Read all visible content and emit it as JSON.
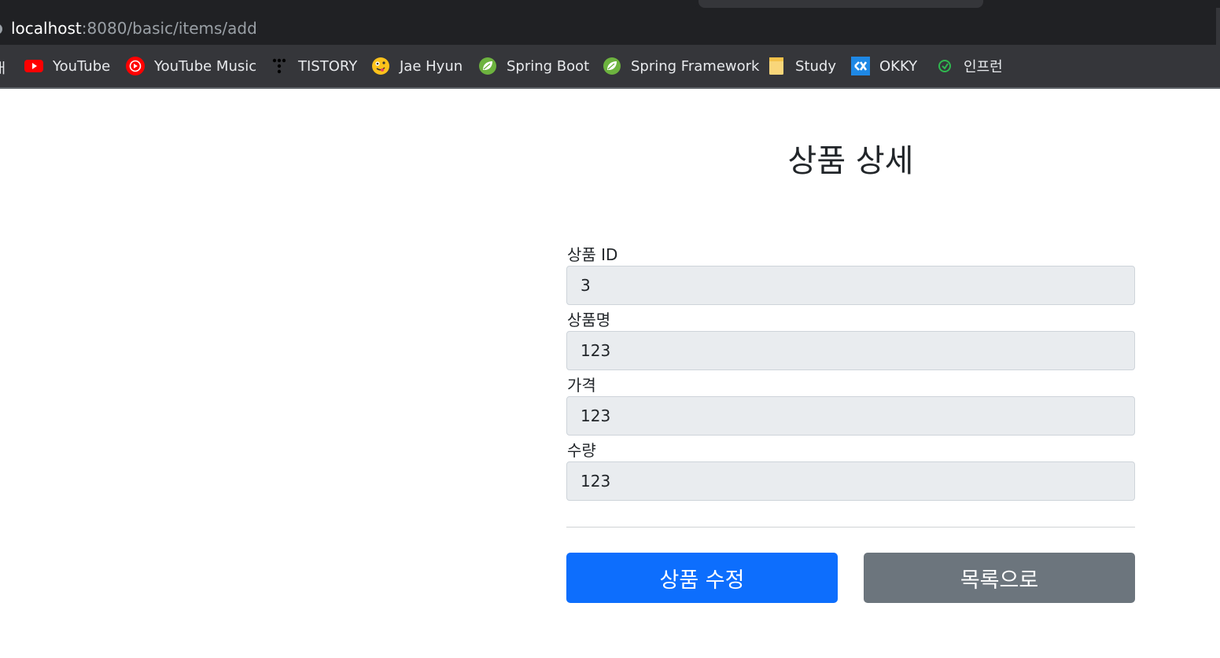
{
  "browser": {
    "url_host": "localhost",
    "url_path": ":8080/basic/items/add",
    "cut_bookmark": "ㅐ",
    "bookmarks": [
      {
        "label": "YouTube",
        "icon": "youtube-icon"
      },
      {
        "label": "YouTube Music",
        "icon": "youtube-music-icon"
      },
      {
        "label": "TISTORY",
        "icon": "tistory-icon"
      },
      {
        "label": "Jae Hyun",
        "icon": "emoji-face-icon"
      },
      {
        "label": "Spring Boot",
        "icon": "spring-leaf-icon"
      },
      {
        "label": "Spring Framework",
        "icon": "spring-leaf-icon"
      },
      {
        "label": "Study",
        "icon": "folder-note-icon"
      },
      {
        "label": "OKKY",
        "icon": "okky-icon"
      },
      {
        "label": "인프런",
        "icon": "inflearn-icon"
      }
    ]
  },
  "page": {
    "title": "상품 상세",
    "fields": [
      {
        "label": "상품 ID",
        "value": "3"
      },
      {
        "label": "상품명",
        "value": "123"
      },
      {
        "label": "가격",
        "value": "123"
      },
      {
        "label": "수량",
        "value": "123"
      }
    ],
    "buttons": {
      "edit": "상품 수정",
      "list": "목록으로"
    }
  },
  "colors": {
    "primary": "#0d6efd",
    "secondary": "#6c757d",
    "readonly_field": "#e9ecef"
  }
}
